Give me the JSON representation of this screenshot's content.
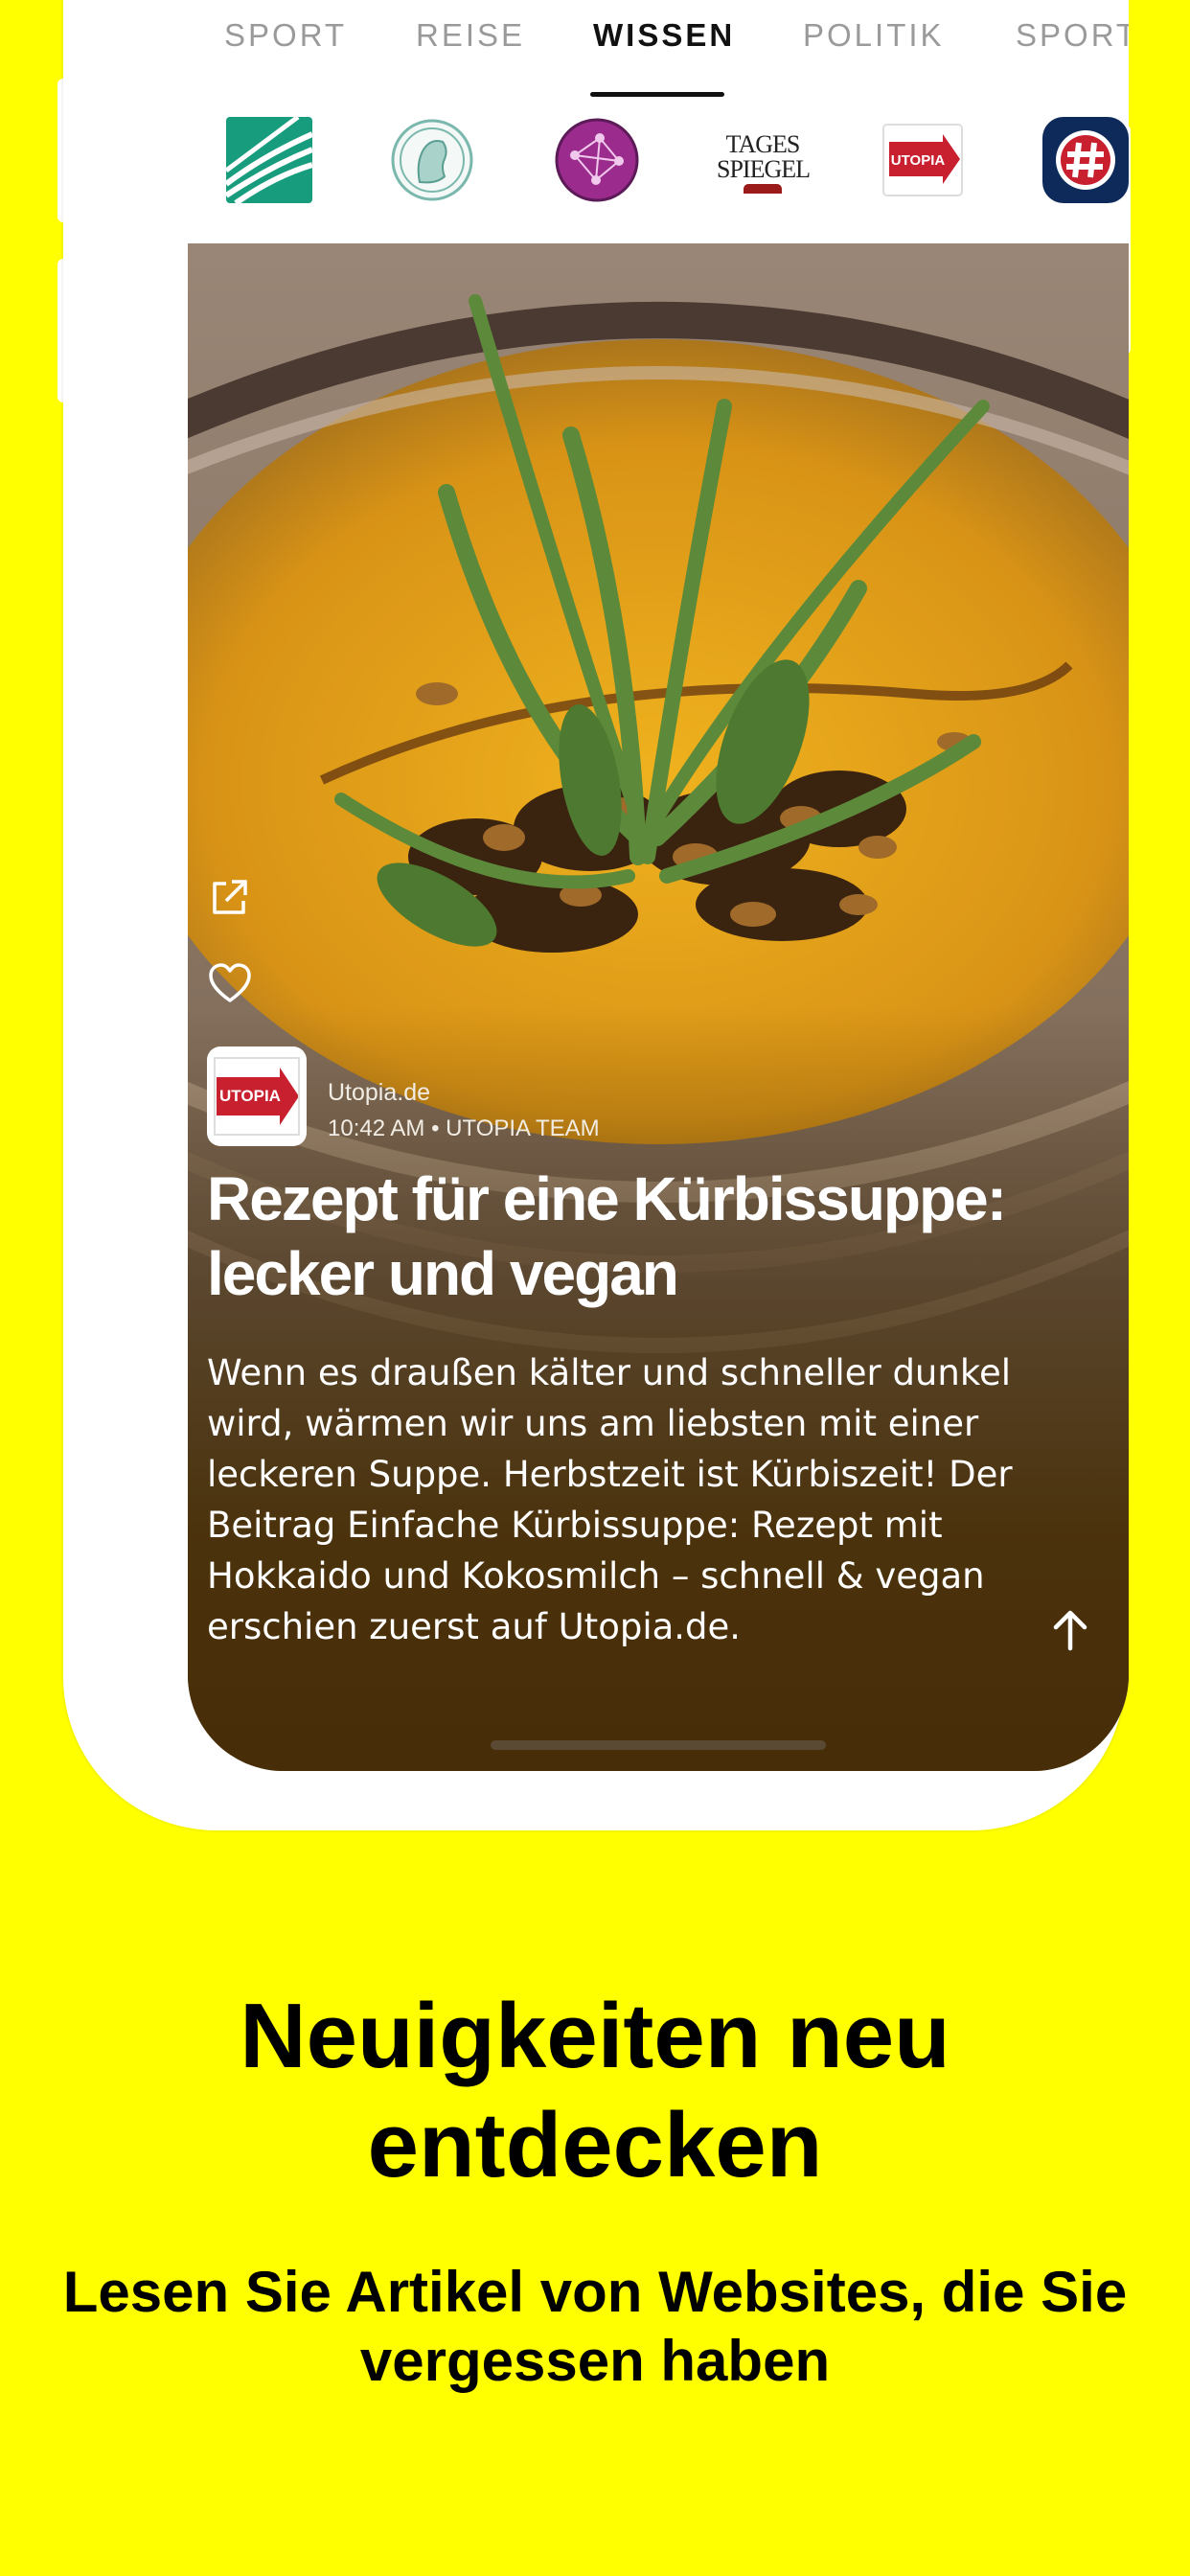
{
  "tabs": [
    {
      "label": "SPORT",
      "active": false
    },
    {
      "label": "REISE",
      "active": false
    },
    {
      "label": "WISSEN",
      "active": true
    },
    {
      "label": "POLITIK",
      "active": false
    },
    {
      "label": "SPORT",
      "active": false
    }
  ],
  "sources": [
    {
      "icon": "fraunhofer-logo-icon"
    },
    {
      "icon": "max-planck-logo-icon"
    },
    {
      "icon": "globe-network-logo-icon"
    },
    {
      "text_line1": "TAGES",
      "text_line2": "SPIEGEL"
    },
    {
      "icon": "utopia-logo-icon"
    },
    {
      "icon": "hashtag-logo-icon"
    }
  ],
  "article": {
    "publisher_logo_text": "UTOPIA",
    "publisher": "Utopia.de",
    "meta": "10:42 AM • UTOPIA TEAM",
    "headline": "Rezept für eine Kürbissuppe: lecker und vegan",
    "summary": "Wenn es draußen kälter und schneller dunkel wird, wärmen wir uns am liebsten mit einer leckeren Suppe. Herbstzeit ist Kürbiszeit! Der Beitrag Einfache Kürbissuppe: Rezept mit Hokkaido und Kokosmilch – schnell & vegan erschien zuerst auf Utopia.de."
  },
  "promo": {
    "title": "Neuigkeiten neu entdecken",
    "subtitle": "Lesen Sie Artikel von Websites, die Sie vergessen haben"
  },
  "colors": {
    "background": "#ffff00",
    "utopia_red": "#c8202f",
    "soup": "#e3a21a"
  }
}
